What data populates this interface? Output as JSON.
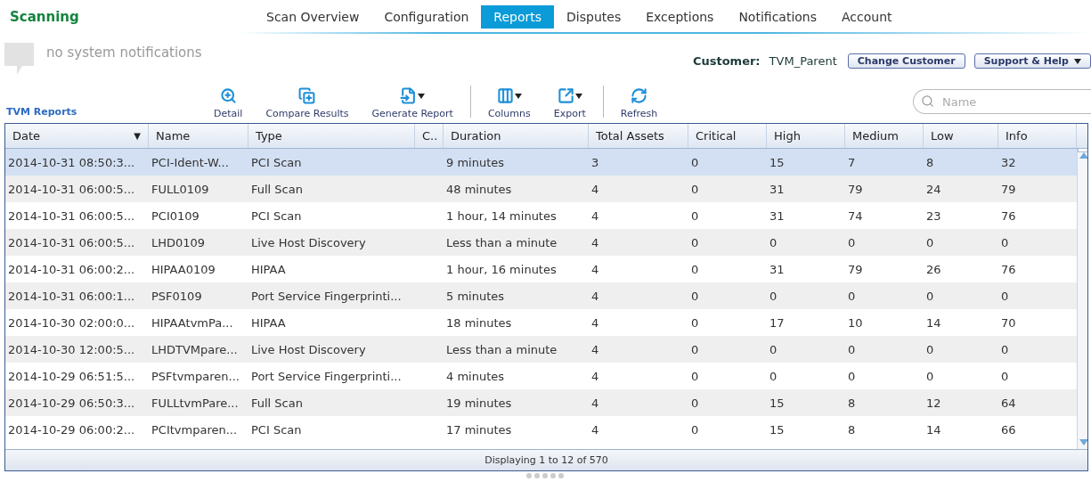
{
  "app": {
    "title": "Scanning"
  },
  "nav_tabs": [
    {
      "label": "Scan Overview",
      "selected": false
    },
    {
      "label": "Configuration",
      "selected": false
    },
    {
      "label": "Reports",
      "selected": true
    },
    {
      "label": "Disputes",
      "selected": false
    },
    {
      "label": "Exceptions",
      "selected": false
    },
    {
      "label": "Notifications",
      "selected": false
    },
    {
      "label": "Account",
      "selected": false
    }
  ],
  "notifications": {
    "text": "no system notifications"
  },
  "customer": {
    "label": "Customer:",
    "value": "TVM_Parent",
    "change_button": "Change Customer",
    "help_button": "Support & Help"
  },
  "section_title": "TVM Reports",
  "toolbar": [
    {
      "kind": "button",
      "label": "Detail",
      "dropdown": false
    },
    {
      "kind": "button",
      "label": "Compare Results",
      "dropdown": false
    },
    {
      "kind": "button",
      "label": "Generate Report",
      "dropdown": true
    },
    {
      "kind": "separator"
    },
    {
      "kind": "button",
      "label": "Columns",
      "dropdown": true
    },
    {
      "kind": "button",
      "label": "Export",
      "dropdown": true
    },
    {
      "kind": "separator"
    },
    {
      "kind": "button",
      "label": "Refresh",
      "dropdown": false
    }
  ],
  "search": {
    "placeholder": "Name"
  },
  "table": {
    "columns": [
      {
        "label": "Date",
        "sort": "▼"
      },
      {
        "label": "Name"
      },
      {
        "label": "Type"
      },
      {
        "label": "C.."
      },
      {
        "label": "Duration"
      },
      {
        "label": "Total Assets"
      },
      {
        "label": "Critical"
      },
      {
        "label": "High"
      },
      {
        "label": "Medium"
      },
      {
        "label": "Low"
      },
      {
        "label": "Info"
      }
    ],
    "rows": [
      {
        "selected": true,
        "cells": [
          "2014-10-31 08:50:3...",
          "PCI-Ident-W...",
          "PCI Scan",
          "",
          "9 minutes",
          "3",
          "0",
          "15",
          "7",
          "8",
          "32"
        ]
      },
      {
        "selected": false,
        "cells": [
          "2014-10-31 06:00:5...",
          "FULL0109",
          "Full Scan",
          "",
          "48 minutes",
          "4",
          "0",
          "31",
          "79",
          "24",
          "79"
        ]
      },
      {
        "selected": false,
        "cells": [
          "2014-10-31 06:00:5...",
          "PCI0109",
          "PCI Scan",
          "",
          "1 hour, 14 minutes",
          "4",
          "0",
          "31",
          "74",
          "23",
          "76"
        ]
      },
      {
        "selected": false,
        "cells": [
          "2014-10-31 06:00:5...",
          "LHD0109",
          "Live Host Discovery",
          "",
          "Less than a minute",
          "4",
          "0",
          "0",
          "0",
          "0",
          "0"
        ]
      },
      {
        "selected": false,
        "cells": [
          "2014-10-31 06:00:2...",
          "HIPAA0109",
          "HIPAA",
          "",
          "1 hour, 16 minutes",
          "4",
          "0",
          "31",
          "79",
          "26",
          "76"
        ]
      },
      {
        "selected": false,
        "cells": [
          "2014-10-31 06:00:1...",
          "PSF0109",
          "Port Service Fingerprinti...",
          "",
          "5 minutes",
          "4",
          "0",
          "0",
          "0",
          "0",
          "0"
        ]
      },
      {
        "selected": false,
        "cells": [
          "2014-10-30 02:00:0...",
          "HIPAAtvmPa...",
          "HIPAA",
          "",
          "18 minutes",
          "4",
          "0",
          "17",
          "10",
          "14",
          "70"
        ]
      },
      {
        "selected": false,
        "cells": [
          "2014-10-30 12:00:5...",
          "LHDTVMpare...",
          "Live Host Discovery",
          "",
          "Less than a minute",
          "4",
          "0",
          "0",
          "0",
          "0",
          "0"
        ]
      },
      {
        "selected": false,
        "cells": [
          "2014-10-29 06:51:5...",
          "PSFtvmparen...",
          "Port Service Fingerprinti...",
          "",
          "4 minutes",
          "4",
          "0",
          "0",
          "0",
          "0",
          "0"
        ]
      },
      {
        "selected": false,
        "cells": [
          "2014-10-29 06:50:3...",
          "FULLtvmPare...",
          "Full Scan",
          "",
          "19 minutes",
          "4",
          "0",
          "15",
          "8",
          "12",
          "64"
        ]
      },
      {
        "selected": false,
        "cells": [
          "2014-10-29 06:00:2...",
          "PCItvmparen...",
          "PCI Scan",
          "",
          "17 minutes",
          "4",
          "0",
          "15",
          "8",
          "14",
          "66"
        ]
      }
    ]
  },
  "status_bar": "Displaying 1 to 12 of 570"
}
